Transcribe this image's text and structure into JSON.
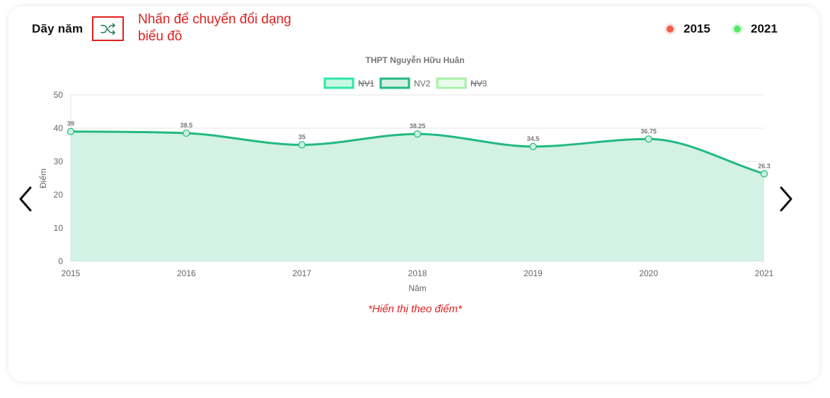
{
  "header": {
    "range_label": "Dãy năm",
    "toggle_hint": "Nhấn để chuyển đổi dạng biểu đồ",
    "year_legend": [
      {
        "label": "2015",
        "color": "#f25c4a"
      },
      {
        "label": "2021",
        "color": "#55e86a"
      }
    ]
  },
  "note": "*Hiển thị theo điểm*",
  "chart_data": {
    "type": "area",
    "title": "THPT Nguyễn Hữu Huân",
    "xlabel": "Năm",
    "ylabel": "Điểm",
    "categories": [
      "2015",
      "2016",
      "2017",
      "2018",
      "2019",
      "2020",
      "2021"
    ],
    "ylim": [
      0,
      50
    ],
    "yticks": [
      0,
      10,
      20,
      30,
      40,
      50
    ],
    "legend": [
      {
        "name": "NV1",
        "color": "#2de8a4",
        "fill": "#c9f7e6",
        "hidden": true
      },
      {
        "name": "NV2",
        "color": "#22b981",
        "fill": "#d3f1e5",
        "hidden": false
      },
      {
        "name": "NV3",
        "color": "#a8f0a8",
        "fill": "#e9fbe9",
        "hidden": true
      }
    ],
    "series": [
      {
        "name": "NV2",
        "values": [
          39,
          38.5,
          35,
          38.25,
          34.5,
          36.75,
          26.3
        ],
        "labels": [
          "39",
          "38.5",
          "35",
          "38.25",
          "34.5",
          "36.75",
          "26.3"
        ]
      }
    ],
    "grid": true,
    "legend_position": "top"
  }
}
